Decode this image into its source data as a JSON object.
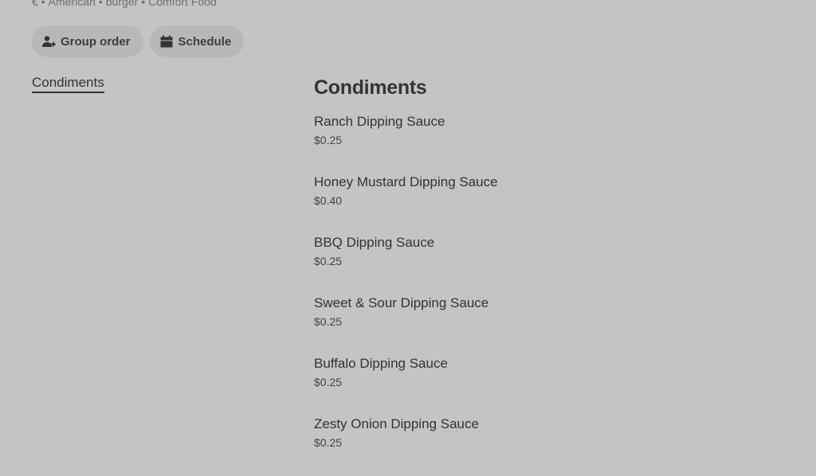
{
  "store_tags": [
    "€",
    "American",
    "burger",
    "Comfort Food"
  ],
  "store_tag_separator": "•",
  "actions": {
    "group_order": {
      "label": "Group order",
      "icon": "add-person-icon"
    },
    "schedule": {
      "label": "Schedule",
      "icon": "calendar-icon"
    }
  },
  "side_nav": {
    "active_label": "Condiments"
  },
  "section": {
    "title": "Condiments",
    "items": [
      {
        "name": "Ranch Dipping Sauce",
        "price": "$0.25"
      },
      {
        "name": "Honey Mustard Dipping Sauce",
        "price": "$0.40"
      },
      {
        "name": "BBQ Dipping Sauce",
        "price": "$0.25"
      },
      {
        "name": "Sweet & Sour Dipping Sauce",
        "price": "$0.25"
      },
      {
        "name": "Buffalo Dipping Sauce",
        "price": "$0.25"
      },
      {
        "name": "Zesty Onion Dipping Sauce",
        "price": "$0.25"
      }
    ]
  }
}
